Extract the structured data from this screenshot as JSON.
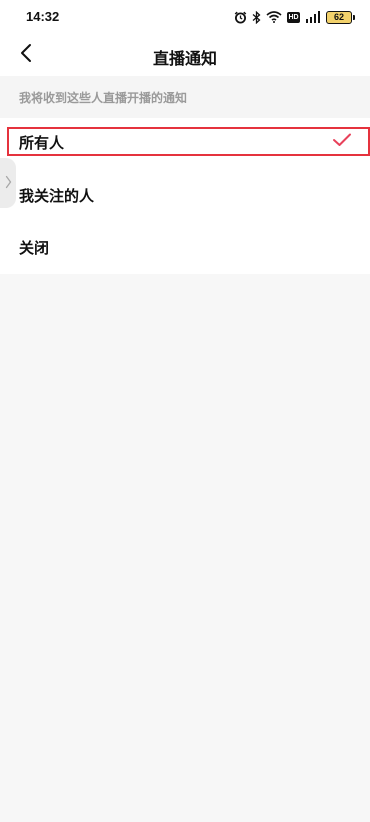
{
  "status_bar": {
    "time": "14:32",
    "battery_level": "62",
    "hd_label": "HD",
    "icons": [
      "alarm-icon",
      "bluetooth-icon",
      "wifi-icon",
      "hd-icon",
      "signal-icon",
      "battery-icon"
    ]
  },
  "nav": {
    "title": "直播通知",
    "back_icon": "chevron-left-icon"
  },
  "section": {
    "header": "我将收到这些人直播开播的通知"
  },
  "options": [
    {
      "label": "所有人",
      "selected": true
    },
    {
      "label": "我关注的人",
      "selected": false
    },
    {
      "label": "关闭",
      "selected": false
    }
  ],
  "colors": {
    "accent": "#e5323d",
    "checkmark": "#e8415a",
    "background": "#f7f7f7",
    "header_text": "#9a9a9a"
  }
}
